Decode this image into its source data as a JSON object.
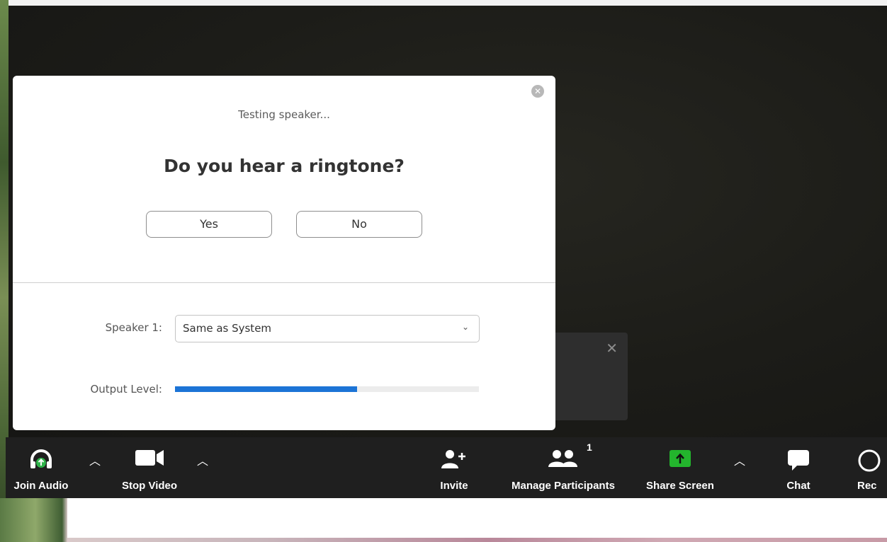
{
  "dialog": {
    "status_text": "Testing speaker...",
    "question": "Do you hear a ringtone?",
    "yes_label": "Yes",
    "no_label": "No",
    "speaker_label": "Speaker 1:",
    "speaker_selected": "Same as System",
    "output_level_label": "Output Level:",
    "output_level_fraction": 0.6
  },
  "toolbar": {
    "join_audio": "Join Audio",
    "stop_video": "Stop Video",
    "invite": "Invite",
    "manage_participants": "Manage Participants",
    "participant_count": "1",
    "share_screen": "Share Screen",
    "chat": "Chat",
    "record": "Rec"
  },
  "colors": {
    "share_green": "#23b52d",
    "level_blue": "#1c74d6",
    "audio_green": "#2fb34a"
  },
  "icons": [
    "headphones-icon",
    "video-camera-icon",
    "add-person-icon",
    "participants-icon",
    "share-screen-icon",
    "chat-icon",
    "record-icon",
    "close-icon",
    "chevron-up-icon",
    "chevron-down-icon"
  ]
}
